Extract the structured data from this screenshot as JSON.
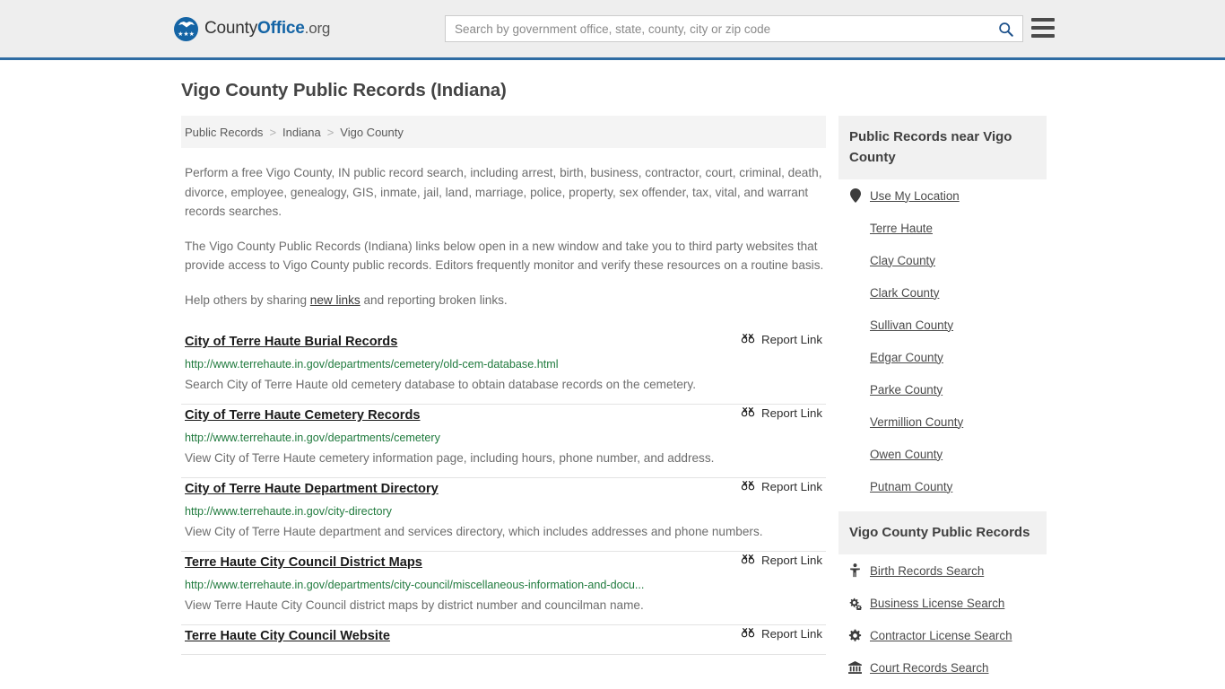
{
  "header": {
    "brand": {
      "part1": "County",
      "part2": "Office",
      "part3": ".org"
    },
    "search": {
      "placeholder": "Search by government office, state, county, city or zip code",
      "value": "",
      "icon": "search-icon"
    },
    "menu_icon": "hamburger-menu-icon",
    "accent_color": "#2f6ca3",
    "background_color": "#eeeeee"
  },
  "page_title": "Vigo County Public Records (Indiana)",
  "breadcrumb": {
    "items": [
      "Public Records",
      "Indiana",
      "Vigo County"
    ],
    "separator": ">"
  },
  "intro": {
    "paragraph1": "Perform a free Vigo County, IN public record search, including arrest, birth, business, contractor, court, criminal, death, divorce, employee, genealogy, GIS, inmate, jail, land, marriage, police, property, sex offender, tax, vital, and warrant records searches.",
    "paragraph2": "The Vigo County Public Records (Indiana) links below open in a new window and take you to third party websites that provide access to Vigo County public records. Editors frequently monitor and verify these resources on a routine basis.",
    "paragraph3_before": "Help others by sharing ",
    "paragraph3_link": "new links",
    "paragraph3_after": " and reporting broken links."
  },
  "report_link_label": "Report Link",
  "report_link_icon": "broken-chain-icon",
  "results": [
    {
      "title": "City of Terre Haute Burial Records",
      "url": "http://www.terrehaute.in.gov/departments/cemetery/old-cem-database.html",
      "description": "Search City of Terre Haute old cemetery database to obtain database records on the cemetery."
    },
    {
      "title": "City of Terre Haute Cemetery Records",
      "url": "http://www.terrehaute.in.gov/departments/cemetery",
      "description": "View City of Terre Haute cemetery information page, including hours, phone number, and address."
    },
    {
      "title": "City of Terre Haute Department Directory",
      "url": "http://www.terrehaute.in.gov/city-directory",
      "description": "View City of Terre Haute department and services directory, which includes addresses and phone numbers."
    },
    {
      "title": "Terre Haute City Council District Maps",
      "url": "http://www.terrehaute.in.gov/departments/city-council/miscellaneous-information-and-docu...",
      "description": "View Terre Haute City Council district maps by district number and councilman name."
    },
    {
      "title": "Terre Haute City Council Website",
      "url": "",
      "description": ""
    }
  ],
  "sidebar": {
    "nearby": {
      "heading": "Public Records near Vigo County",
      "items": [
        {
          "label": "Use My Location",
          "icon": "map-pin-icon"
        },
        {
          "label": "Terre Haute",
          "icon": ""
        },
        {
          "label": "Clay County",
          "icon": ""
        },
        {
          "label": "Clark County",
          "icon": ""
        },
        {
          "label": "Sullivan County",
          "icon": ""
        },
        {
          "label": "Edgar County",
          "icon": ""
        },
        {
          "label": "Parke County",
          "icon": ""
        },
        {
          "label": "Vermillion County",
          "icon": ""
        },
        {
          "label": "Owen County",
          "icon": ""
        },
        {
          "label": "Putnam County",
          "icon": ""
        }
      ]
    },
    "records": {
      "heading": "Vigo County Public Records",
      "items": [
        {
          "label": "Birth Records Search",
          "icon": "baby-icon"
        },
        {
          "label": "Business License Search",
          "icon": "cogs-icon"
        },
        {
          "label": "Contractor License Search",
          "icon": "cog-icon"
        },
        {
          "label": "Court Records Search",
          "icon": "courthouse-icon"
        }
      ]
    }
  }
}
